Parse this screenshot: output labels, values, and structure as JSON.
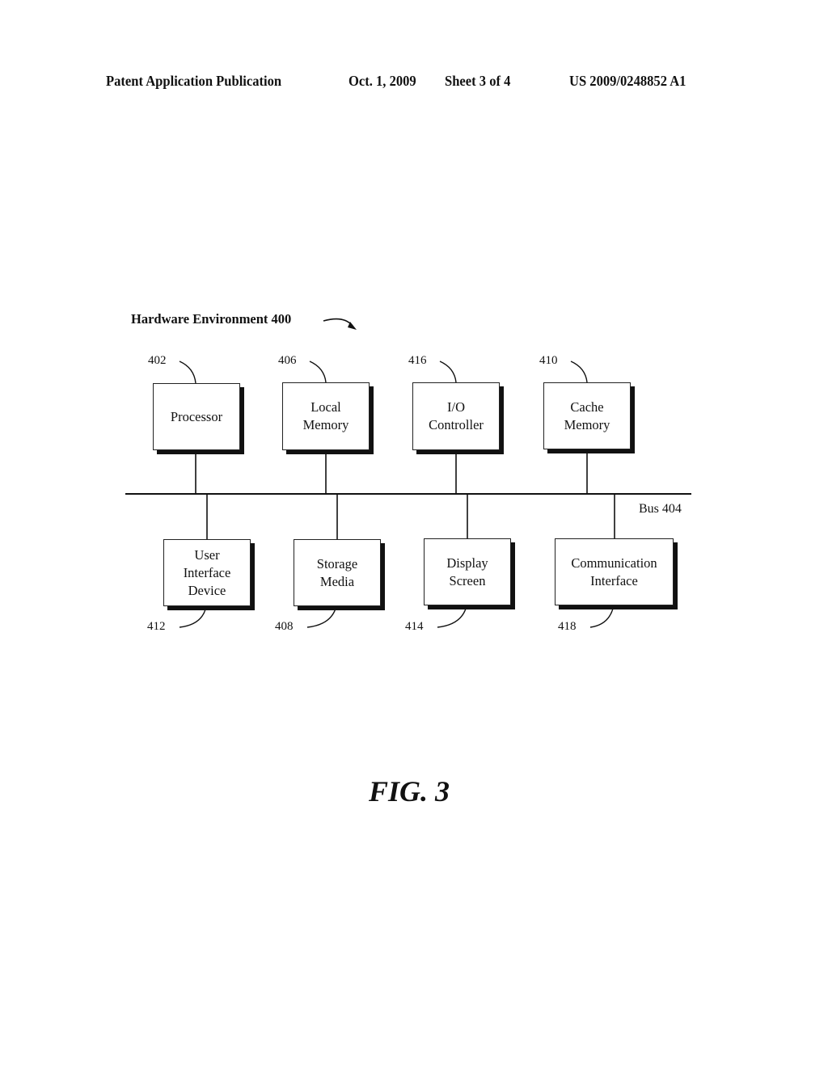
{
  "header": {
    "left": "Patent Application Publication",
    "date": "Oct. 1, 2009",
    "sheet": "Sheet 3 of 4",
    "number": "US 2009/0248852 A1"
  },
  "diagram": {
    "title": "Hardware Environment 400",
    "bus_label": "Bus 404",
    "top_components": [
      {
        "ref": "402",
        "lines": [
          "Processor"
        ]
      },
      {
        "ref": "406",
        "lines": [
          "Local",
          "Memory"
        ]
      },
      {
        "ref": "416",
        "lines": [
          "I/O",
          "Controller"
        ]
      },
      {
        "ref": "410",
        "lines": [
          "Cache",
          "Memory"
        ]
      }
    ],
    "bottom_components": [
      {
        "ref": "412",
        "lines": [
          "User",
          "Interface",
          "Device"
        ]
      },
      {
        "ref": "408",
        "lines": [
          "Storage",
          "Media"
        ]
      },
      {
        "ref": "414",
        "lines": [
          "Display",
          "Screen"
        ]
      },
      {
        "ref": "418",
        "lines": [
          "Communication",
          "Interface"
        ]
      }
    ]
  },
  "figure_label": "FIG. 3"
}
